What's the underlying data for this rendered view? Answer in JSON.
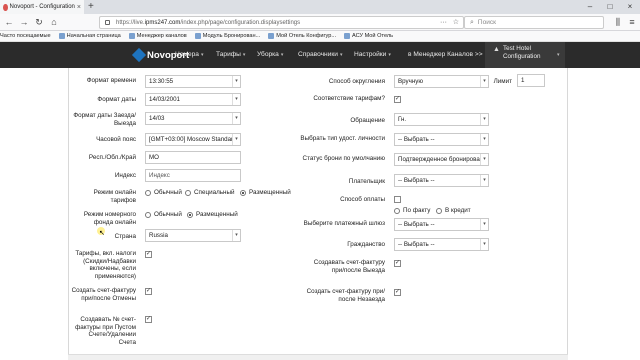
{
  "browser": {
    "tab_title": "Novoport - Configuration",
    "url_prefix": "https://live.",
    "url_domain": "ipms247.com",
    "url_path": "/index.php/page/configuration.displaysettings",
    "search_placeholder": "Поиск",
    "bookmarks": [
      "Часто посещаемые",
      "Начальная страница",
      "Менеджер каналов",
      "Модуль Бронирован...",
      "Мой Отель Конфигур...",
      "АСУ Мой Отель"
    ]
  },
  "app": {
    "logo": "Novoport",
    "menu": [
      "Номера",
      "Тарифы",
      "Уборка",
      "Справочники",
      "Настройки",
      "в Менеджер Каналов >>"
    ],
    "hotel_line1": "Test Hotel",
    "hotel_line2": "Configuration"
  },
  "form_left": {
    "time_format": {
      "label": "Формат времени",
      "value": "13:30:55"
    },
    "date_format": {
      "label": "Формат даты",
      "value": "14/03/2001"
    },
    "arrival_date_format": {
      "label": "Формат даты Заезда/Выезда",
      "value": "14/03"
    },
    "timezone": {
      "label": "Часовой пояс",
      "value": "[GMT+03:00] Moscow Standar"
    },
    "region": {
      "label": "Респ./Обл./Край",
      "value": "MO"
    },
    "zip": {
      "label": "Индекс",
      "value": "Индекс"
    },
    "online_rates_mode": {
      "label": "Режим онлайн тарифов",
      "options": [
        "Обычный",
        "Специальный",
        "Размещенный"
      ],
      "selected": "Размещенный"
    },
    "room_fund_mode": {
      "label": "Режим номерного фонда онлайн",
      "options": [
        "Обычный",
        "Размещенный"
      ],
      "selected": "Размещенный"
    },
    "country": {
      "label": "Страна",
      "value": "Russia"
    },
    "rates_incl_taxes": {
      "label": "Тарифы, вкл. налоги (Скидки/Надбавки включены, если применяются)",
      "checked": true
    },
    "invoice_after_cancel": {
      "label": "Создать счет-фактуру при/после Отмены",
      "checked": true
    },
    "invoice_empty_account": {
      "label": "Создавать № счет-фактуры при Пустом Счете/Удалении Счета",
      "checked": true
    }
  },
  "form_right": {
    "rounding": {
      "label": "Способ округления",
      "value": "Вручную"
    },
    "limit": {
      "label": "Лимит",
      "value": "1"
    },
    "rate_match": {
      "label": "Соответствие тарифам?",
      "checked": true
    },
    "salutation": {
      "label": "Обращение",
      "value": "Гн."
    },
    "id_type": {
      "label": "Выбрать тип удост. личности",
      "value": "-- Выбрать --"
    },
    "default_status": {
      "label": "Статус брони по умолчанию",
      "value": "Подтвержденное бронирова"
    },
    "payer": {
      "label": "Плательщик",
      "value": "-- Выбрать --"
    },
    "payment_method": {
      "label": "Способ оплаты",
      "checked": false
    },
    "payment_options": [
      "По факту",
      "В кредит"
    ],
    "payment_gateway": {
      "label": "Выберите платежный шлюз",
      "value": "-- Выбрать --"
    },
    "citizenship": {
      "label": "Гражданство",
      "value": "-- Выбрать --"
    },
    "invoice_after_checkout": {
      "label": "Создавать счет-фактуру при/после Выезда",
      "checked": true
    },
    "invoice_after_noshow": {
      "label": "Создать счет-фактуру при/после Незаезда",
      "checked": true
    }
  },
  "icons": {
    "checkmark": "✓",
    "dropdown": "▾"
  }
}
